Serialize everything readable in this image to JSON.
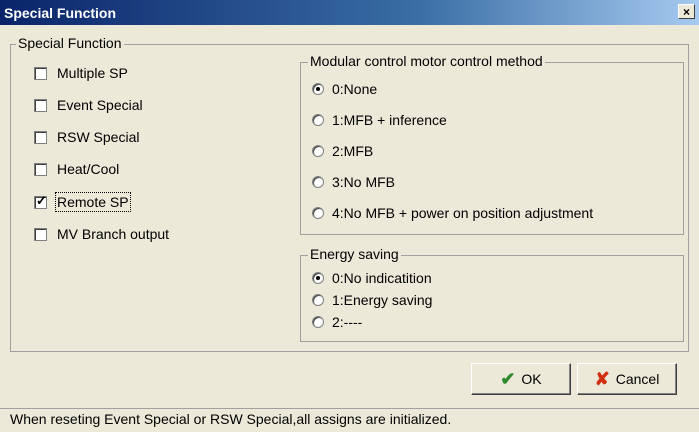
{
  "window": {
    "title": "Special Function",
    "close_glyph": "×"
  },
  "special_function": {
    "legend": "Special Function",
    "options": [
      {
        "label": "Multiple SP",
        "checked": false
      },
      {
        "label": "Event Special",
        "checked": false
      },
      {
        "label": "RSW Special",
        "checked": false
      },
      {
        "label": "Heat/Cool",
        "checked": false
      },
      {
        "label": "Remote SP",
        "checked": true
      },
      {
        "label": "MV Branch output",
        "checked": false
      }
    ]
  },
  "motor_control": {
    "legend": "Modular control motor control method",
    "options": [
      {
        "label": "0:None",
        "selected": true
      },
      {
        "label": "1:MFB + inference",
        "selected": false
      },
      {
        "label": "2:MFB",
        "selected": false
      },
      {
        "label": "3:No MFB",
        "selected": false
      },
      {
        "label": "4:No MFB + power on position adjustment",
        "selected": false
      }
    ]
  },
  "energy_saving": {
    "legend": "Energy saving",
    "options": [
      {
        "label": "0:No indicatition",
        "selected": true
      },
      {
        "label": "1:Energy saving",
        "selected": false
      },
      {
        "label": "2:----",
        "selected": false
      }
    ]
  },
  "buttons": {
    "ok": {
      "label": "OK",
      "icon": "checkmark-icon",
      "color": "#2e8b2e"
    },
    "cancel": {
      "label": "Cancel",
      "icon": "x-cancel-icon",
      "color": "#d03010"
    }
  },
  "status": "When reseting Event Special or RSW Special,all assigns are initialized."
}
